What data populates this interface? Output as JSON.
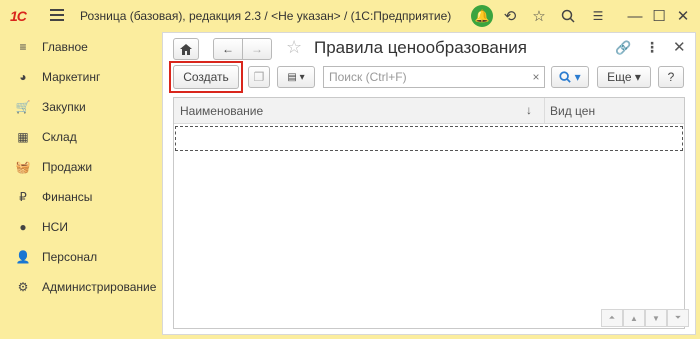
{
  "titlebar": {
    "logo": "1С",
    "title": "Розница (базовая), редакция 2.3 / <Не указан> /  (1С:Предприятие)",
    "icons": [
      "bell-icon",
      "history-icon",
      "star-icon",
      "search-icon",
      "menu-icon",
      "minimize-icon",
      "maximize-icon",
      "close-icon"
    ]
  },
  "sidebar": {
    "items": [
      {
        "label": "Главное",
        "icon": "≡"
      },
      {
        "label": "Маркетинг",
        "icon": "◕"
      },
      {
        "label": "Закупки",
        "icon": "🛒"
      },
      {
        "label": "Склад",
        "icon": "▦"
      },
      {
        "label": "Продажи",
        "icon": "🧺"
      },
      {
        "label": "Финансы",
        "icon": "₽"
      },
      {
        "label": "НСИ",
        "icon": "●"
      },
      {
        "label": "Персонал",
        "icon": "👤"
      },
      {
        "label": "Администрирование",
        "icon": "⚙"
      }
    ]
  },
  "form": {
    "title": "Правила ценообразования",
    "create_label": "Создать",
    "search_placeholder": "Поиск (Ctrl+F)",
    "more_label": "Еще",
    "help_label": "?",
    "columns": [
      "Наименование",
      "Вид цен"
    ],
    "sort_indicator": "↓"
  },
  "colors": {
    "background": "#fbed9e",
    "highlight": "#d9261c",
    "notify": "#3aa43f"
  }
}
